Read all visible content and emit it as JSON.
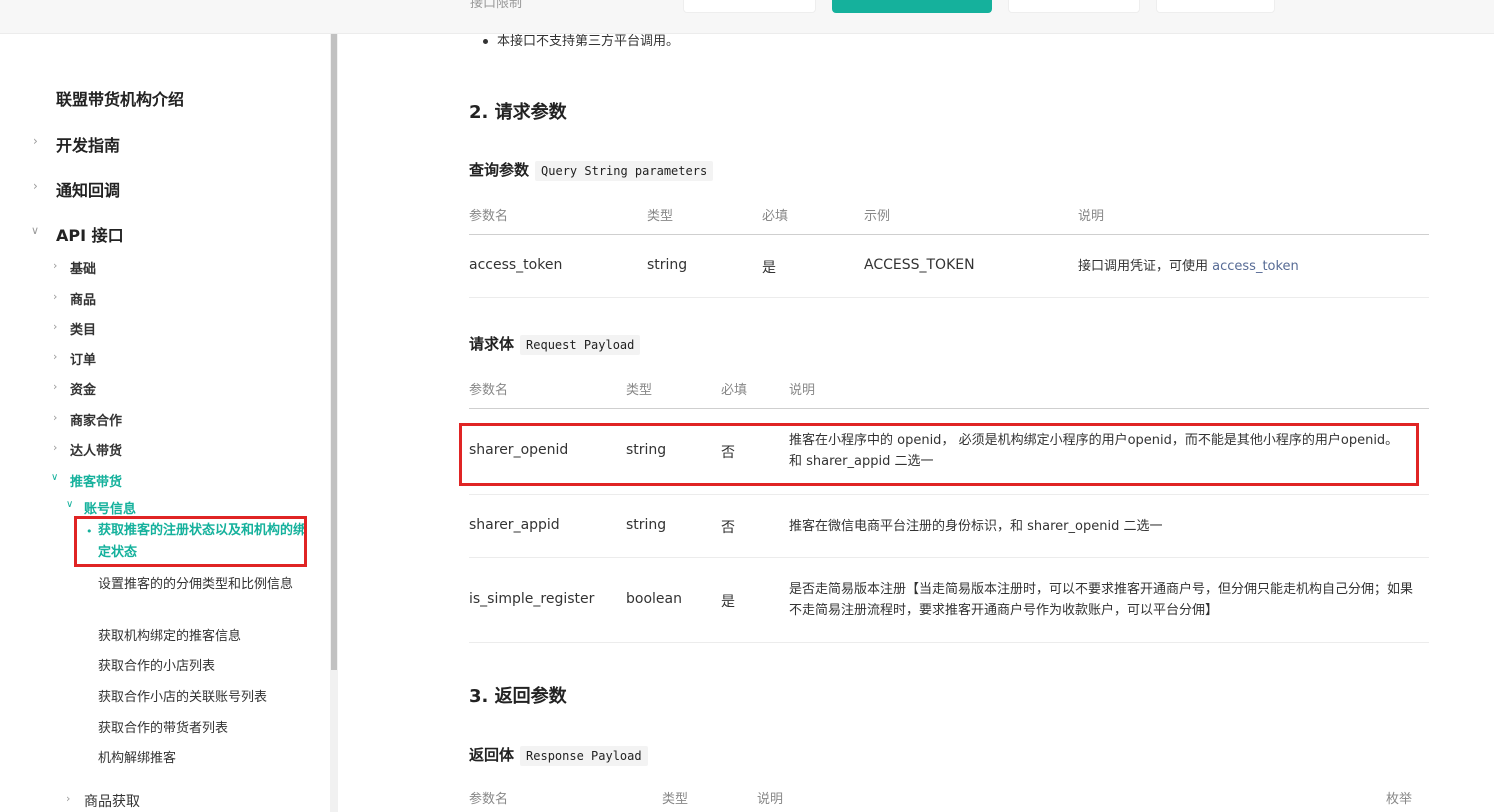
{
  "top_fade": "接口限制",
  "sidebar": {
    "title": "联盟带货机构介绍",
    "sections": [
      "开发指南",
      "通知回调",
      "API 接口"
    ],
    "api_items": [
      "基础",
      "商品",
      "类目",
      "订单",
      "资金",
      "商家合作",
      "达人带货",
      "推客带货"
    ],
    "account_group": "账号信息",
    "account_items": [
      "获取推客的注册状态以及和机构的绑定状态",
      "设置推客的的分佣类型和比例信息",
      "获取机构绑定的推客信息",
      "获取合作的小店列表",
      "获取合作小店的关联账号列表",
      "获取合作的带货者列表",
      "机构解绑推客"
    ],
    "bottom_item": "商品获取"
  },
  "content": {
    "note": "本接口不支持第三方平台调用。",
    "section2_title": "2. 请求参数",
    "query": {
      "title": "查询参数",
      "code": "Query String parameters",
      "headers": [
        "参数名",
        "类型",
        "必填",
        "示例",
        "说明"
      ],
      "row": {
        "name": "access_token",
        "type": "string",
        "required": "是",
        "example": "ACCESS_TOKEN",
        "desc_prefix": "接口调用凭证，可使用 ",
        "desc_link": "access_token"
      }
    },
    "payload": {
      "title": "请求体",
      "code": "Request Payload",
      "headers": [
        "参数名",
        "类型",
        "必填",
        "说明"
      ],
      "rows": [
        {
          "name": "sharer_openid",
          "type": "string",
          "required": "否",
          "desc": "推客在小程序中的 openid， 必须是机构绑定小程序的用户openid，而不能是其他小程序的用户openid。 和 sharer_appid 二选一"
        },
        {
          "name": "sharer_appid",
          "type": "string",
          "required": "否",
          "desc": "推客在微信电商平台注册的身份标识，和 sharer_openid 二选一"
        },
        {
          "name": "is_simple_register",
          "type": "boolean",
          "required": "是",
          "desc": "是否走简易版本注册【当走简易版本注册时，可以不要求推客开通商户号，但分佣只能走机构自己分佣；如果不走简易注册流程时，要求推客开通商户号作为收款账户，可以平台分佣】"
        }
      ]
    },
    "section3_title": "3. 返回参数",
    "response": {
      "title": "返回体",
      "code": "Response Payload",
      "headers": [
        "参数名",
        "类型",
        "说明",
        "枚举"
      ]
    }
  }
}
